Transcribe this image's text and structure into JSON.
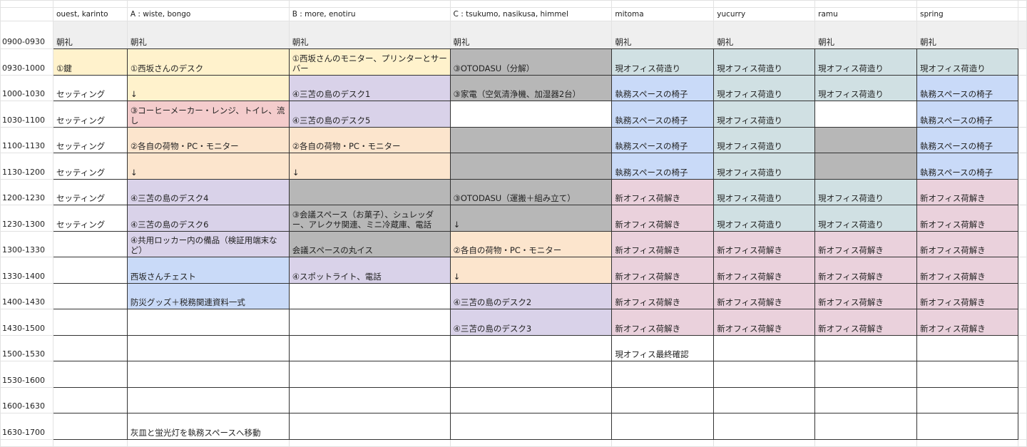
{
  "colors": {
    "w": "#ffffff",
    "y": "#fff2cc",
    "p": "#f4cccc",
    "o": "#fce5cd",
    "l": "#d9d2e9",
    "g": "#b7b7b7",
    "b": "#c9daf8",
    "t": "#d0e0e3",
    "k": "#ead1dc"
  },
  "columns": [
    "ouest, karinto",
    "A : wiste, bongo",
    "B : more, enotiru",
    "C : tsukumo, nasikusa, himmel",
    "mitoma",
    "yucurry",
    "ramu",
    "spring"
  ],
  "chorei": {
    "time": "0900-0930",
    "label": "朝礼"
  },
  "rows": [
    {
      "time": "0930-1000",
      "cells": [
        [
          "①鍵",
          "y"
        ],
        [
          "①西坂さんのデスク",
          "y"
        ],
        [
          "①西坂さんのモニター、プリンターとサーバー",
          "y"
        ],
        [
          "③OTODASU（分解）",
          "g"
        ],
        [
          "現オフィス荷造り",
          "t"
        ],
        [
          "現オフィス荷造り",
          "t"
        ],
        [
          "現オフィス荷造り",
          "t"
        ],
        [
          "現オフィス荷造り",
          "t"
        ]
      ]
    },
    {
      "time": "1000-1030",
      "cells": [
        [
          "セッティング",
          "w"
        ],
        [
          "↓",
          "y"
        ],
        [
          "④三苫の島のデスク1",
          "l"
        ],
        [
          "③家電（空気清浄機、加湿器2台）",
          "g"
        ],
        [
          "執務スペースの椅子",
          "b"
        ],
        [
          "現オフィス荷造り",
          "t"
        ],
        [
          "現オフィス荷造り",
          "t"
        ],
        [
          "執務スペースの椅子",
          "b"
        ]
      ]
    },
    {
      "time": "1030-1100",
      "cells": [
        [
          "セッティング",
          "w"
        ],
        [
          "③コーヒーメーカー・レンジ、トイレ、流し",
          "p"
        ],
        [
          "④三苫の島のデスク5",
          "l"
        ],
        [
          "",
          "w"
        ],
        [
          "執務スペースの椅子",
          "b"
        ],
        [
          "現オフィス荷造り",
          "t"
        ],
        [
          "",
          "w"
        ],
        [
          "執務スペースの椅子",
          "b"
        ]
      ]
    },
    {
      "time": "1100-1130",
      "cells": [
        [
          "セッティング",
          "w"
        ],
        [
          "②各自の荷物・PC・モニター",
          "o"
        ],
        [
          "②各自の荷物・PC・モニター",
          "o"
        ],
        [
          "",
          "g"
        ],
        [
          "執務スペースの椅子",
          "b"
        ],
        [
          "現オフィス荷造り",
          "t"
        ],
        [
          "",
          "g"
        ],
        [
          "執務スペースの椅子",
          "b"
        ]
      ]
    },
    {
      "time": "1130-1200",
      "cells": [
        [
          "セッティング",
          "w"
        ],
        [
          "↓",
          "o"
        ],
        [
          "↓",
          "o"
        ],
        [
          "",
          "g"
        ],
        [
          "執務スペースの椅子",
          "b"
        ],
        [
          "現オフィス荷造り",
          "t"
        ],
        [
          "",
          "g"
        ],
        [
          "執務スペースの椅子",
          "b"
        ]
      ]
    },
    {
      "time": "1200-1230",
      "cells": [
        [
          "セッティング",
          "w"
        ],
        [
          "④三苫の島のデスク4",
          "l"
        ],
        [
          "",
          "g"
        ],
        [
          "③OTODASU（運搬＋組み立て）",
          "g"
        ],
        [
          "新オフィス荷解き",
          "k"
        ],
        [
          "現オフィス荷造り",
          "t"
        ],
        [
          "現オフィス荷造り",
          "t"
        ],
        [
          "新オフィス荷解き",
          "k"
        ]
      ]
    },
    {
      "time": "1230-1300",
      "cells": [
        [
          "セッティング",
          "w"
        ],
        [
          "④三苫の島のデスク6",
          "l"
        ],
        [
          "③会議スペース（お菓子）、シュレッダー、アレクサ関連、ミニ冷蔵庫、電話",
          "g"
        ],
        [
          "↓",
          "g"
        ],
        [
          "新オフィス荷解き",
          "k"
        ],
        [
          "現オフィス荷造り",
          "t"
        ],
        [
          "現オフィス荷造り",
          "t"
        ],
        [
          "新オフィス荷解き",
          "k"
        ]
      ]
    },
    {
      "time": "1300-1330",
      "cells": [
        [
          "",
          "w"
        ],
        [
          "④共用ロッカー内の備品（検証用端末など）",
          "l"
        ],
        [
          "会議スペースの丸イス",
          "g"
        ],
        [
          "②各自の荷物・PC・モニター",
          "o"
        ],
        [
          "新オフィス荷解き",
          "k"
        ],
        [
          "新オフィス荷解き",
          "k"
        ],
        [
          "新オフィス荷解き",
          "k"
        ],
        [
          "新オフィス荷解き",
          "k"
        ]
      ]
    },
    {
      "time": "1330-1400",
      "cells": [
        [
          "",
          "w"
        ],
        [
          "西坂さんチェスト",
          "b"
        ],
        [
          "④スポットライト、電話",
          "l"
        ],
        [
          "↓",
          "o"
        ],
        [
          "新オフィス荷解き",
          "k"
        ],
        [
          "新オフィス荷解き",
          "k"
        ],
        [
          "新オフィス荷解き",
          "k"
        ],
        [
          "新オフィス荷解き",
          "k"
        ]
      ]
    },
    {
      "time": "1400-1430",
      "cells": [
        [
          "",
          "w"
        ],
        [
          "防災グッズ＋税務関連資料一式",
          "b"
        ],
        [
          "",
          "w"
        ],
        [
          "④三苫の島のデスク2",
          "l"
        ],
        [
          "新オフィス荷解き",
          "k"
        ],
        [
          "新オフィス荷解き",
          "k"
        ],
        [
          "新オフィス荷解き",
          "k"
        ],
        [
          "新オフィス荷解き",
          "k"
        ]
      ]
    },
    {
      "time": "1430-1500",
      "cells": [
        [
          "",
          "w"
        ],
        [
          "",
          "w"
        ],
        [
          "",
          "w"
        ],
        [
          "④三苫の島のデスク3",
          "l"
        ],
        [
          "新オフィス荷解き",
          "k"
        ],
        [
          "新オフィス荷解き",
          "k"
        ],
        [
          "新オフィス荷解き",
          "k"
        ],
        [
          "新オフィス荷解き",
          "k"
        ]
      ]
    },
    {
      "time": "1500-1530",
      "cells": [
        [
          "",
          "w"
        ],
        [
          "",
          "w"
        ],
        [
          "",
          "w"
        ],
        [
          "",
          "w"
        ],
        [
          "現オフィス最終確認",
          "w"
        ],
        [
          "",
          "w"
        ],
        [
          "",
          "w"
        ],
        [
          "",
          "w"
        ]
      ]
    },
    {
      "time": "1530-1600",
      "cells": [
        [
          "",
          "w"
        ],
        [
          "",
          "w"
        ],
        [
          "",
          "w"
        ],
        [
          "",
          "w"
        ],
        [
          "",
          "w"
        ],
        [
          "",
          "w"
        ],
        [
          "",
          "w"
        ],
        [
          "",
          "w"
        ]
      ]
    },
    {
      "time": "1600-1630",
      "cells": [
        [
          "",
          "w"
        ],
        [
          "",
          "w"
        ],
        [
          "",
          "w"
        ],
        [
          "",
          "w"
        ],
        [
          "",
          "w"
        ],
        [
          "",
          "w"
        ],
        [
          "",
          "w"
        ],
        [
          "",
          "w"
        ]
      ]
    },
    {
      "time": "1630-1700",
      "cells": [
        [
          "",
          "w"
        ],
        [
          "灰皿と蛍光灯を執務スペースへ移動",
          "w"
        ],
        [
          "",
          "w"
        ],
        [
          "",
          "w"
        ],
        [
          "",
          "w"
        ],
        [
          "",
          "w"
        ],
        [
          "",
          "w"
        ],
        [
          "",
          "w"
        ]
      ]
    }
  ]
}
